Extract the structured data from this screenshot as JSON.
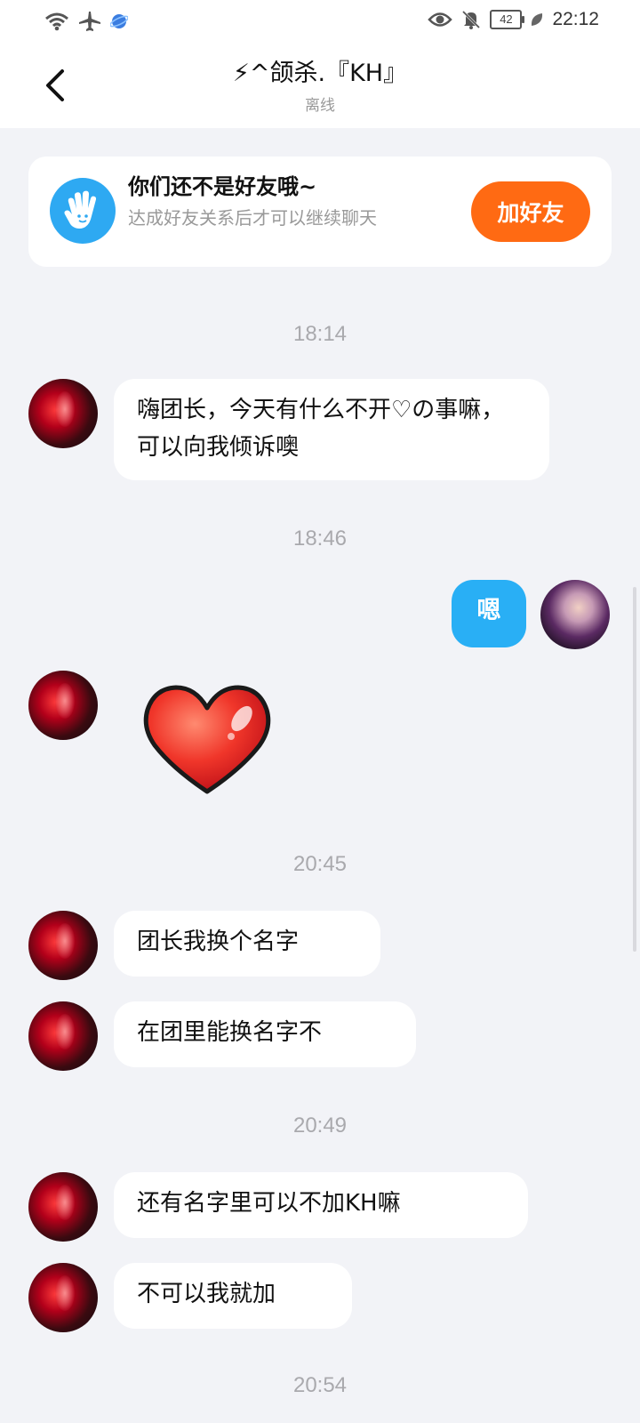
{
  "status_bar": {
    "time": "22:12",
    "battery": "42",
    "icons": [
      "wifi-icon",
      "airplane-icon",
      "globe-icon",
      "eye-icon",
      "bell-muted-icon",
      "battery-icon",
      "leaf-icon"
    ]
  },
  "header": {
    "title": "⚡^颌杀.『KH』",
    "status": "离线"
  },
  "friend_banner": {
    "title": "你们还不是好友哦~",
    "description": "达成好友关系后才可以继续聊天",
    "button_label": "加好友",
    "icon": "wave-hand-icon"
  },
  "messages": {
    "t1": "18:14",
    "m1": "嗨团长，今天有什么不开♡の事嘛，可以向我倾诉噢",
    "t2": "18:46",
    "m2": "嗯",
    "t3": "20:45",
    "m3": "团长我换个名字",
    "m4": "在团里能换名字不",
    "t4": "20:49",
    "m5": "还有名字里可以不加KH嘛",
    "m6": "不可以我就加",
    "t5": "20:54"
  },
  "colors": {
    "accent_blue": "#29aff5",
    "add_button": "#ff6a13",
    "background": "#f2f3f7"
  }
}
